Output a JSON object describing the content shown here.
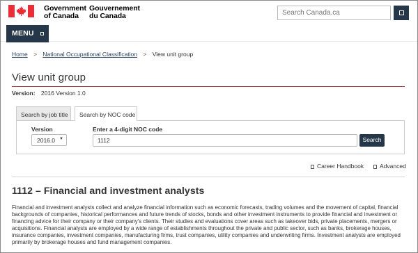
{
  "header": {
    "gov_en_line1": "Government",
    "gov_en_line2": "of Canada",
    "gov_fr_line1": "Gouvernement",
    "gov_fr_line2": "du Canada",
    "search_placeholder": "Search Canada.ca",
    "accent_color": "#26374a",
    "flag_color": "#ea2d37"
  },
  "menu": {
    "label": "MENU"
  },
  "breadcrumb": {
    "home": "Home",
    "noc": "National Occupational Classification",
    "current": "View unit group",
    "separator": ">"
  },
  "page": {
    "title": "View unit group",
    "version_label": "Version:",
    "version_value": "2016 Version 1.0"
  },
  "tabs": [
    {
      "label": "Search by job title",
      "active": false
    },
    {
      "label": "Search by NOC code",
      "active": true
    }
  ],
  "form": {
    "version_label": "Version",
    "version_selected": "2016.0",
    "noc_label": "Enter a 4-digit NOC code",
    "noc_value": "1112",
    "search_button": "Search"
  },
  "links": {
    "career_handbook": "Career Handbook",
    "advanced": "Advanced"
  },
  "unit_group": {
    "title": "1112 – Financial and investment analysts",
    "description": "Financial and investment analysts collect and analyze financial information such as economic forecasts, trading volumes and the movement of capital, financial backgrounds of companies, historical performances and future trends of stocks, bonds and other investment instruments to provide financial and investment or financing advice for their company or their company's clients. Their studies and evaluations cover areas such as takeover bids, private placements, mergers or acquisitions. Financial analysts are employed by a wide range of establishments throughout the private and public sector, such as banks, brokerage houses, insurance companies, investment companies, manufacturing firms, trust companies, utility companies and underwriting firms. Investment analysts are employed primarily by brokerage houses and fund management companies."
  }
}
